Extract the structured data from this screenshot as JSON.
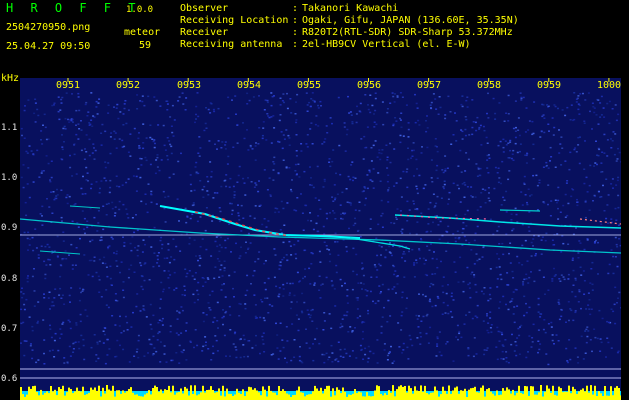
{
  "header": {
    "app_title": "H R O F F T",
    "version": "1.0.0",
    "filename": "2504270950.png",
    "datetime": "25.04.27 09:50",
    "class_label": "meteor",
    "class_count": "59"
  },
  "info": [
    {
      "key": "Observer",
      "value": "Takanori Kawachi"
    },
    {
      "key": "Receiving Location",
      "value": "Ogaki, Gifu, JAPAN (136.60E, 35.35N)"
    },
    {
      "key": "Receiver",
      "value": "R820T2(RTL-SDR) SDR-Sharp 53.372MHz"
    },
    {
      "key": "Receiving antenna",
      "value": "2el-HB9CV Vertical (el. E-W)"
    }
  ],
  "colon": ":",
  "unit": "kHz",
  "time_labels": [
    "0951",
    "0952",
    "0953",
    "0954",
    "0955",
    "0956",
    "0957",
    "0958",
    "0959",
    "1000"
  ],
  "freq_labels": [
    "1.1",
    "1.0",
    "0.9",
    "0.8",
    "0.7",
    "0.6"
  ],
  "colors": {
    "background_noise": "#101a8c",
    "trace_cyan": "#00ffff",
    "trace_red": "#ff3030",
    "signal_yellow": "#ffff00",
    "ref_line": "#d0d0ff"
  }
}
